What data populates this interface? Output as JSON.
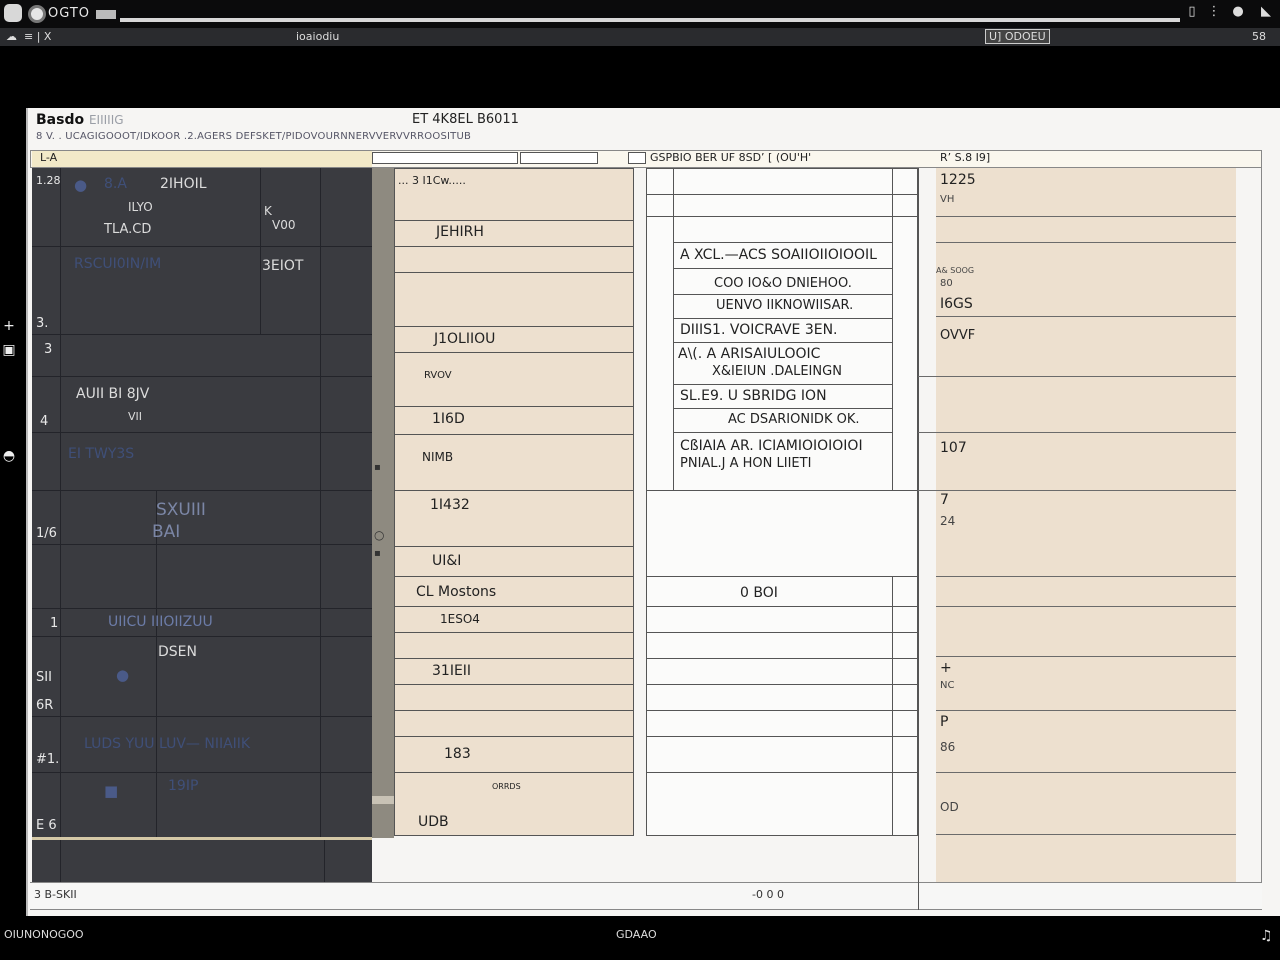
{
  "window": {
    "app_name": "OGTO",
    "doc_title": "ioaiodiu",
    "mode_label": "U] ODOEU",
    "zoom": "58"
  },
  "sheet": {
    "title": "Basdo",
    "title_faint": "EIIIIIG",
    "ref": "ET 4K8EL B6011",
    "subtitle": "8 V. . UCAGIGOOOT/IDKOOR .2.AGERS DEFSKET/PIDOVOURNNERVVERVVRROOSITUB",
    "col_head_left": "L-A",
    "col_head_mid": "GSPBIO BER UF 8SD’ [ (OU'H'",
    "col_head_right": "R’ S.8 I9]"
  },
  "dark_rows": {
    "row_nums": [
      "1.28",
      "3.",
      "3",
      "4",
      "1/6",
      "1",
      "SII",
      "6R",
      "#1.",
      "E 6"
    ],
    "labels": [
      "8.A",
      "2IHOIL",
      "ILYO",
      "TLA.CD",
      "K",
      "V00",
      "RSCUI0IN/IM",
      "3EIOT",
      "AUII BI 8JV",
      "VII",
      "EI TWY3S",
      "SXUIII",
      "BAI",
      "UIICU IIIOIIZUU",
      "DSEN",
      "LUDS YUU LUV— NIIAIIK",
      "19IP"
    ]
  },
  "tan_col": {
    "items": [
      "... 3 I1Cw.....",
      "JEHIRH",
      "J1OLIIOU",
      "RVOV",
      "1I6D",
      "NIMB",
      "1I432",
      "UI&I",
      "CL Mostons",
      "1ESO4",
      "31IEII",
      "183",
      "ORRDS",
      "UDB"
    ]
  },
  "mid_table": {
    "rows": [
      "A XCL.—ACS SOAIIOIIOIOOIL",
      "COO IO&O DNIEHOO.",
      "UENVO IIKNOWIISAR.",
      "DIIIS1. VOICRAVE 3EN.",
      "A\\(. A ARISAIULOOIC",
      "X&IEIUN .DALEINGN",
      "SL.E9. U SBRIDG ION",
      "AC DSARIONIDK OK.",
      "CßIAIA AR. ICIAMIOIOIOIOI",
      "PNIAL.J A HON LIIETI",
      "0 BOI"
    ]
  },
  "right_panel": {
    "values": [
      "1225",
      "VH",
      "A& SOOG",
      "80",
      "I6GS",
      "OVVF",
      "107",
      "7",
      "24",
      "+",
      "NC",
      "P",
      "86",
      "OD"
    ]
  },
  "footer": {
    "left": "3 B-SKII",
    "mid": "-0 0 0"
  },
  "status": {
    "left": "OIUNONOGOO",
    "mid": "GDAAO",
    "right": "♫"
  }
}
